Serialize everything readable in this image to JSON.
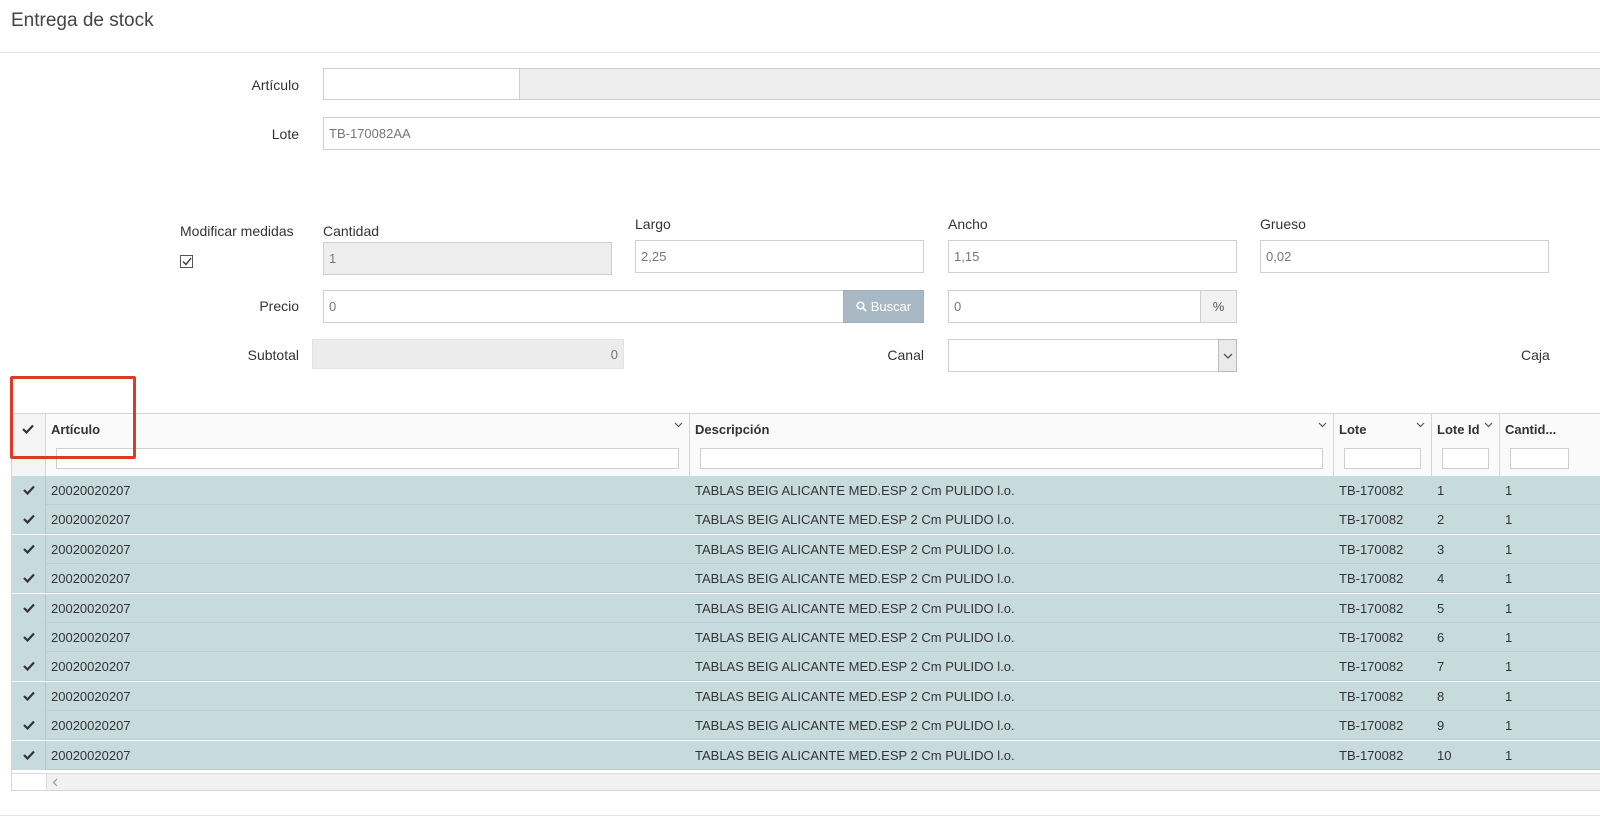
{
  "page": {
    "title": "Entrega de stock"
  },
  "form": {
    "articulo_label": "Artículo",
    "articulo_value": "",
    "articulo_desc": "",
    "lote_label": "Lote",
    "lote_value": "TB-170082AA",
    "modificar_medidas_label": "Modificar medidas",
    "modificar_medidas_checked": true,
    "cantidad_label": "Cantidad",
    "cantidad_value": "1",
    "largo_label": "Largo",
    "largo_value": "2,25",
    "ancho_label": "Ancho",
    "ancho_value": "1,15",
    "grueso_label": "Grueso",
    "grueso_value": "0,02",
    "precio_label": "Precio",
    "precio_value": "0",
    "buscar_label": "Buscar",
    "descuento_value": "0",
    "percent_label": "%",
    "subtotal_label": "Subtotal",
    "subtotal_value": "0",
    "canal_label": "Canal",
    "canal_value": "",
    "caja_label": "Caja"
  },
  "grid": {
    "columns": [
      "Artículo",
      "Descripción",
      "Lote",
      "Lote Id",
      "Cantid..."
    ],
    "rows": [
      {
        "articulo": "20020020207",
        "descripcion": "TABLAS BEIG ALICANTE MED.ESP 2 Cm PULIDO l.o.",
        "lote": "TB-170082",
        "lote_id": "1",
        "cantidad": "1"
      },
      {
        "articulo": "20020020207",
        "descripcion": "TABLAS BEIG ALICANTE MED.ESP 2 Cm PULIDO l.o.",
        "lote": "TB-170082",
        "lote_id": "2",
        "cantidad": "1"
      },
      {
        "articulo": "20020020207",
        "descripcion": "TABLAS BEIG ALICANTE MED.ESP 2 Cm PULIDO l.o.",
        "lote": "TB-170082",
        "lote_id": "3",
        "cantidad": "1"
      },
      {
        "articulo": "20020020207",
        "descripcion": "TABLAS BEIG ALICANTE MED.ESP 2 Cm PULIDO l.o.",
        "lote": "TB-170082",
        "lote_id": "4",
        "cantidad": "1"
      },
      {
        "articulo": "20020020207",
        "descripcion": "TABLAS BEIG ALICANTE MED.ESP 2 Cm PULIDO l.o.",
        "lote": "TB-170082",
        "lote_id": "5",
        "cantidad": "1"
      },
      {
        "articulo": "20020020207",
        "descripcion": "TABLAS BEIG ALICANTE MED.ESP 2 Cm PULIDO l.o.",
        "lote": "TB-170082",
        "lote_id": "6",
        "cantidad": "1"
      },
      {
        "articulo": "20020020207",
        "descripcion": "TABLAS BEIG ALICANTE MED.ESP 2 Cm PULIDO l.o.",
        "lote": "TB-170082",
        "lote_id": "7",
        "cantidad": "1"
      },
      {
        "articulo": "20020020207",
        "descripcion": "TABLAS BEIG ALICANTE MED.ESP 2 Cm PULIDO l.o.",
        "lote": "TB-170082",
        "lote_id": "8",
        "cantidad": "1"
      },
      {
        "articulo": "20020020207",
        "descripcion": "TABLAS BEIG ALICANTE MED.ESP 2 Cm PULIDO l.o.",
        "lote": "TB-170082",
        "lote_id": "9",
        "cantidad": "1"
      },
      {
        "articulo": "20020020207",
        "descripcion": "TABLAS BEIG ALICANTE MED.ESP 2 Cm PULIDO l.o.",
        "lote": "TB-170082",
        "lote_id": "10",
        "cantidad": "1"
      }
    ]
  },
  "icons": {
    "header_check": "check-icon",
    "row_check": "check-icon",
    "sort": "chevron-down-icon",
    "search": "search-icon",
    "scroll_left": "chevron-left-icon"
  },
  "colors": {
    "row_selected": "#c7dbdf",
    "buscar_button": "#a8b8c4",
    "highlight_box": "#dd3a26"
  }
}
